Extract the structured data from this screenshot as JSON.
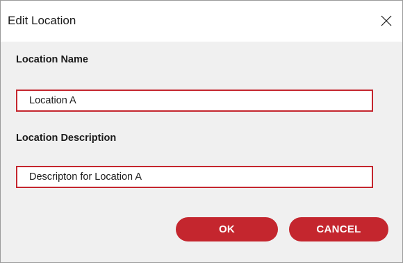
{
  "dialog": {
    "title": "Edit Location",
    "close_icon": "close-icon"
  },
  "form": {
    "name_label": "Location Name",
    "name_value": "Location A",
    "description_label": "Location Description",
    "description_value": "Descripton for Location A"
  },
  "buttons": {
    "ok_label": "OK",
    "cancel_label": "CANCEL"
  },
  "colors": {
    "accent": "#c4262e",
    "background": "#f0f0f0",
    "titlebar": "#ffffff"
  }
}
